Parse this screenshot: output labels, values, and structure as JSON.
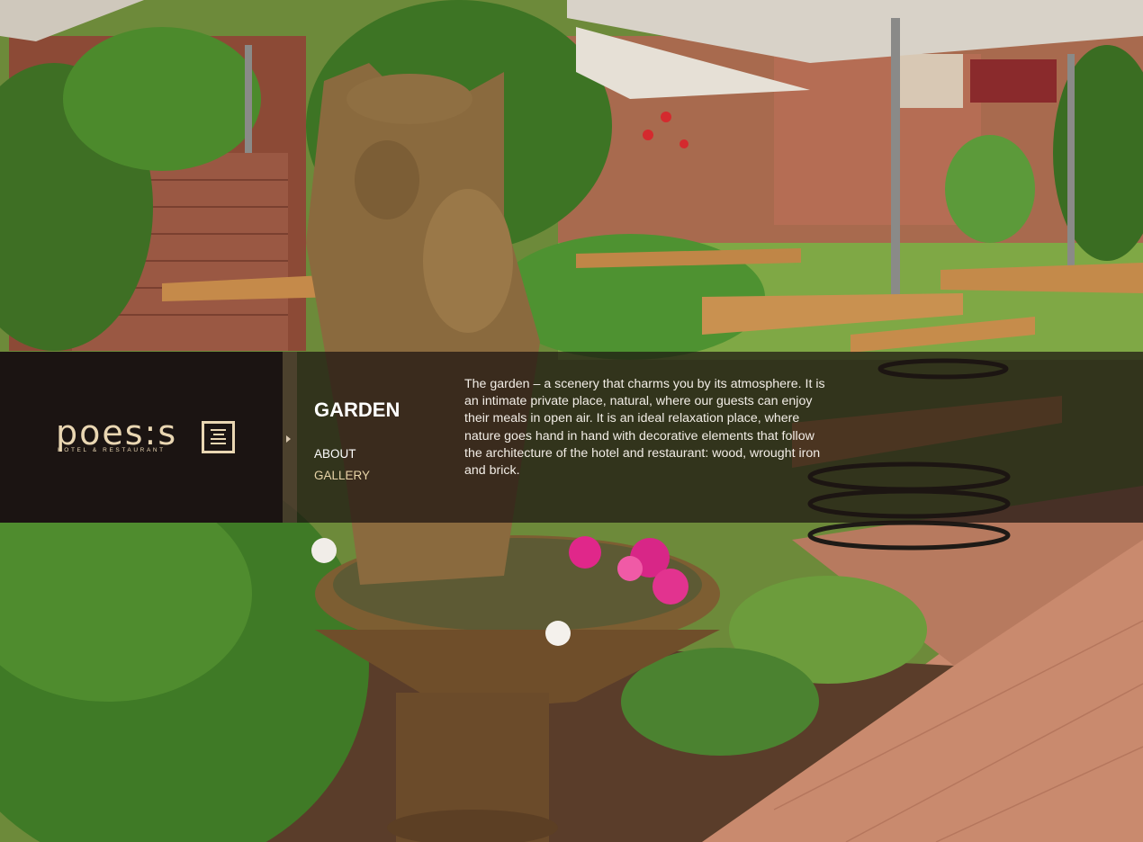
{
  "brand": {
    "logo_text": "poes:s",
    "logo_subtitle": "HOTEL & RESTAURANT"
  },
  "section": {
    "title": "GARDEN"
  },
  "subnav": {
    "about_label": "ABOUT",
    "gallery_label": "GALLERY"
  },
  "description": "The garden – a scenery that charms you by its atmosphere. It is an intimate private place, natural, where our guests can enjoy their meals in open air. It is an ideal relaxation place, where nature goes hand in hand with decorative elements that follow the architecture of the hotel and restaurant: wood, wrought iron and brick.",
  "colors": {
    "band_dark": "#1b1412",
    "logo_gold": "#e9d6b2",
    "gallery_link": "#e8d4a8",
    "text_light": "#f2ede6"
  },
  "icons": {
    "logo_mark": "menu-book-icon",
    "submenu_arrow": "arrow-right-icon"
  }
}
